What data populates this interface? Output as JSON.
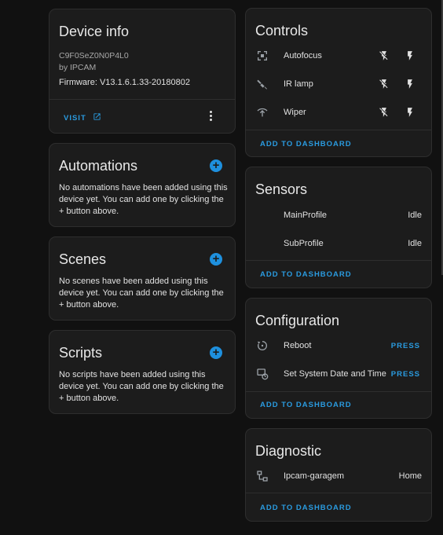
{
  "device_info": {
    "title": "Device info",
    "model": "C9F0SeZ0N0P4L0",
    "manufacturer": "by IPCAM",
    "firmware": "Firmware: V13.1.6.1.33-20180802",
    "visit_label": "VISIT"
  },
  "automations": {
    "title": "Automations",
    "text": "No automations have been added using this device yet. You can add one by clicking the + button above."
  },
  "scenes": {
    "title": "Scenes",
    "text": "No scenes have been added using this device yet. You can add one by clicking the + button above."
  },
  "scripts": {
    "title": "Scripts",
    "text": "No scripts have been added using this device yet. You can add one by clicking the + button above."
  },
  "controls": {
    "title": "Controls",
    "items": [
      {
        "label": "Autofocus",
        "icon": "focus-icon"
      },
      {
        "label": "IR lamp",
        "icon": "lamp-icon"
      },
      {
        "label": "Wiper",
        "icon": "wiper-icon"
      }
    ],
    "add_label": "ADD TO DASHBOARD"
  },
  "sensors": {
    "title": "Sensors",
    "items": [
      {
        "label": "MainProfile",
        "value": "Idle"
      },
      {
        "label": "SubProfile",
        "value": "Idle"
      }
    ],
    "add_label": "ADD TO DASHBOARD"
  },
  "configuration": {
    "title": "Configuration",
    "items": [
      {
        "label": "Reboot",
        "action": "PRESS",
        "icon": "restart-icon"
      },
      {
        "label": "Set System Date and Time",
        "action": "PRESS",
        "icon": "clock-sync-icon"
      }
    ],
    "add_label": "ADD TO DASHBOARD"
  },
  "diagnostic": {
    "title": "Diagnostic",
    "items": [
      {
        "label": "Ipcam-garagem",
        "value": "Home",
        "icon": "network-icon"
      }
    ],
    "add_label": "ADD TO DASHBOARD"
  },
  "colors": {
    "accent": "#2a9be0",
    "card": "#1c1c1c",
    "background": "#111111"
  }
}
